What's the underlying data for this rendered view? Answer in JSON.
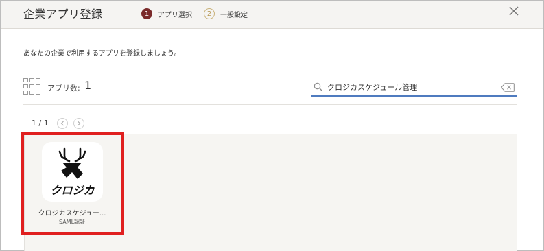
{
  "dialog": {
    "title": "企業アプリ登録",
    "close_icon": "close-icon"
  },
  "steps": [
    {
      "number": "1",
      "label": "アプリ選択",
      "state": "active"
    },
    {
      "number": "2",
      "label": "一般設定",
      "state": "inactive"
    }
  ],
  "description": "あなたの企業で利用するアプリを登録しましょう。",
  "app_count": {
    "label": "アプリ数:",
    "value": "1",
    "icon": "grid-icon"
  },
  "search": {
    "value": "クロジカスケジュール管理",
    "icon": "search-icon",
    "clear_icon": "clear-icon"
  },
  "pagination": {
    "text": "1 / 1",
    "prev_icon": "chevron-left-icon",
    "next_icon": "chevron-right-icon"
  },
  "apps": [
    {
      "name": "クロジカスケジュー...",
      "subtitle": "SAML認証",
      "logo_text": "クロジカ",
      "highlighted": true
    }
  ],
  "colors": {
    "header_bg": "#f5f4f2",
    "step_active": "#7a2a2a",
    "step_inactive": "#b89a55",
    "search_underline": "#4f7bbf",
    "highlight": "#e02020",
    "apps_area_bg": "#f6f5f2"
  }
}
